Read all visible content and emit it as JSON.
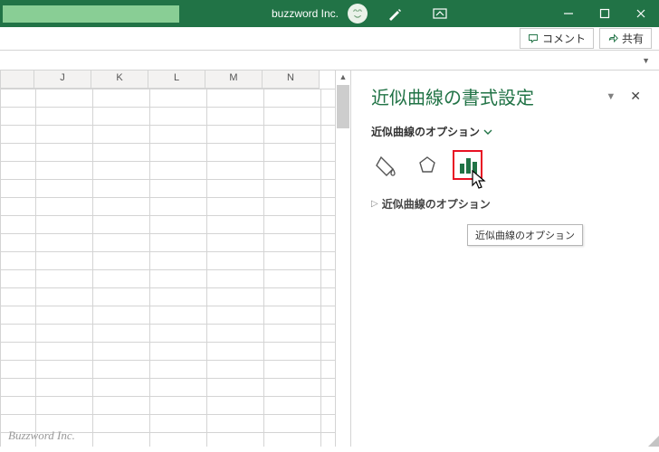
{
  "title": "buzzword Inc.",
  "windowControls": {
    "minimize": "minimize",
    "restore": "restore",
    "close": "close"
  },
  "ribbon": {
    "comment_label": "コメント",
    "share_label": "共有"
  },
  "columns": [
    "",
    "J",
    "K",
    "L",
    "M",
    "N"
  ],
  "pane": {
    "title": "近似曲線の書式設定",
    "sub_link": "近似曲線のオプション",
    "section": "近似曲線のオプション",
    "tooltip": "近似曲線のオプション",
    "icons": {
      "fill": "fill-outline-icon",
      "effects": "effects-icon",
      "chart": "chart-icon"
    }
  },
  "watermark": "Buzzword Inc."
}
